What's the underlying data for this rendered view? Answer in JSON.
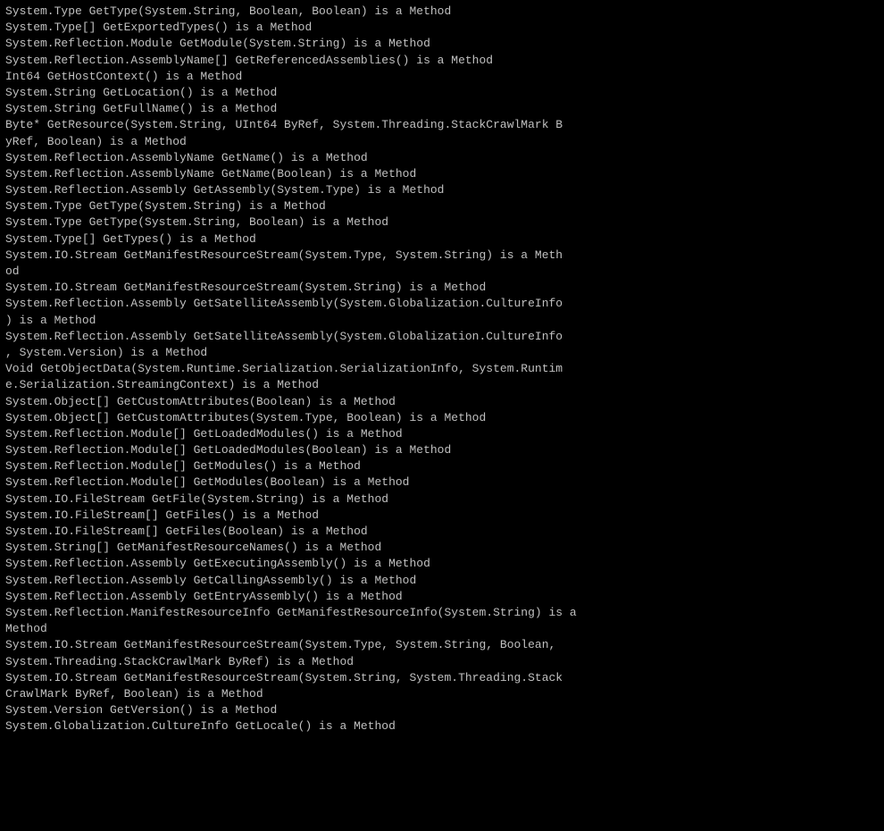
{
  "content": {
    "lines": [
      "System.Type GetType(System.String, Boolean, Boolean) is a Method",
      "System.Type[] GetExportedTypes() is a Method",
      "System.Reflection.Module GetModule(System.String) is a Method",
      "System.Reflection.AssemblyName[] GetReferencedAssemblies() is a Method",
      "Int64 GetHostContext() is a Method",
      "System.String GetLocation() is a Method",
      "System.String GetFullName() is a Method",
      "Byte* GetResource(System.String, UInt64 ByRef, System.Threading.StackCrawlMark ByRef, Boolean) is a Method",
      "System.Reflection.AssemblyName GetName() is a Method",
      "System.Reflection.AssemblyName GetName(Boolean) is a Method",
      "System.Reflection.Assembly GetAssembly(System.Type) is a Method",
      "System.Type GetType(System.String) is a Method",
      "System.Type GetType(System.String, Boolean) is a Method",
      "System.Type[] GetTypes() is a Method",
      "System.IO.Stream GetManifestResourceStream(System.Type, System.String) is a Method",
      "System.IO.Stream GetManifestResourceStream(System.String) is a Method",
      "System.Reflection.Assembly GetSatelliteAssembly(System.Globalization.CultureInfo) is a Method",
      "System.Reflection.Assembly GetSatelliteAssembly(System.Globalization.CultureInfo, System.Version) is a Method",
      "Void GetObjectData(System.Runtime.Serialization.SerializationInfo, System.Runtime.Serialization.StreamingContext) is a Method",
      "System.Object[] GetCustomAttributes(Boolean) is a Method",
      "System.Object[] GetCustomAttributes(System.Type, Boolean) is a Method",
      "System.Reflection.Module[] GetLoadedModules() is a Method",
      "System.Reflection.Module[] GetLoadedModules(Boolean) is a Method",
      "System.Reflection.Module[] GetModules() is a Method",
      "System.Reflection.Module[] GetModules(Boolean) is a Method",
      "System.IO.FileStream GetFile(System.String) is a Method",
      "System.IO.FileStream[] GetFiles() is a Method",
      "System.IO.FileStream[] GetFiles(Boolean) is a Method",
      "System.String[] GetManifestResourceNames() is a Method",
      "System.Reflection.Assembly GetExecutingAssembly() is a Method",
      "System.Reflection.Assembly GetCallingAssembly() is a Method",
      "System.Reflection.Assembly GetEntryAssembly() is a Method",
      "System.Reflection.ManifestResourceInfo GetManifestResourceInfo(System.String) is a Method",
      "System.IO.Stream GetManifestResourceStream(System.Type, System.String, Boolean, System.Threading.StackCrawlMark ByRef) is a Method",
      "System.IO.Stream GetManifestResourceStream(System.String, System.Threading.StackCrawlMark ByRef, Boolean) is a Method",
      "System.Version GetVersion() is a Method",
      "System.Globalization.CultureInfo GetLocale() is a Method"
    ]
  }
}
